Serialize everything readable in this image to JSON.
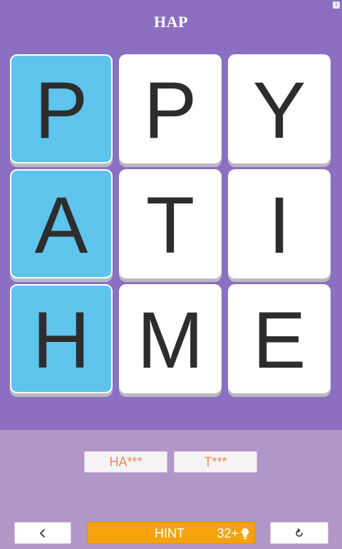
{
  "header": {
    "title": "HAP",
    "info_icon": "info-icon",
    "info_glyph": "i"
  },
  "grid": {
    "rows": 3,
    "cols": 3,
    "tiles": [
      {
        "letter": "P",
        "selected": true
      },
      {
        "letter": "P",
        "selected": false
      },
      {
        "letter": "Y",
        "selected": false
      },
      {
        "letter": "A",
        "selected": true
      },
      {
        "letter": "T",
        "selected": false
      },
      {
        "letter": "I",
        "selected": false
      },
      {
        "letter": "H",
        "selected": true
      },
      {
        "letter": "M",
        "selected": false
      },
      {
        "letter": "E",
        "selected": false
      }
    ]
  },
  "words": [
    {
      "text": "HA***"
    },
    {
      "text": "T***"
    }
  ],
  "controls": {
    "back_icon": "chevron-left-icon",
    "hint_label": "HINT",
    "hint_cost": "32+",
    "hint_icon": "lightbulb-icon",
    "reset_icon": "refresh-icon"
  },
  "colors": {
    "background": "#8c6fc2",
    "bottom_panel": "#b296c8",
    "tile": "#ffffff",
    "tile_selected": "#5fc4ec",
    "hint_button": "#f5a30c",
    "word_text": "#ef8a5e"
  }
}
